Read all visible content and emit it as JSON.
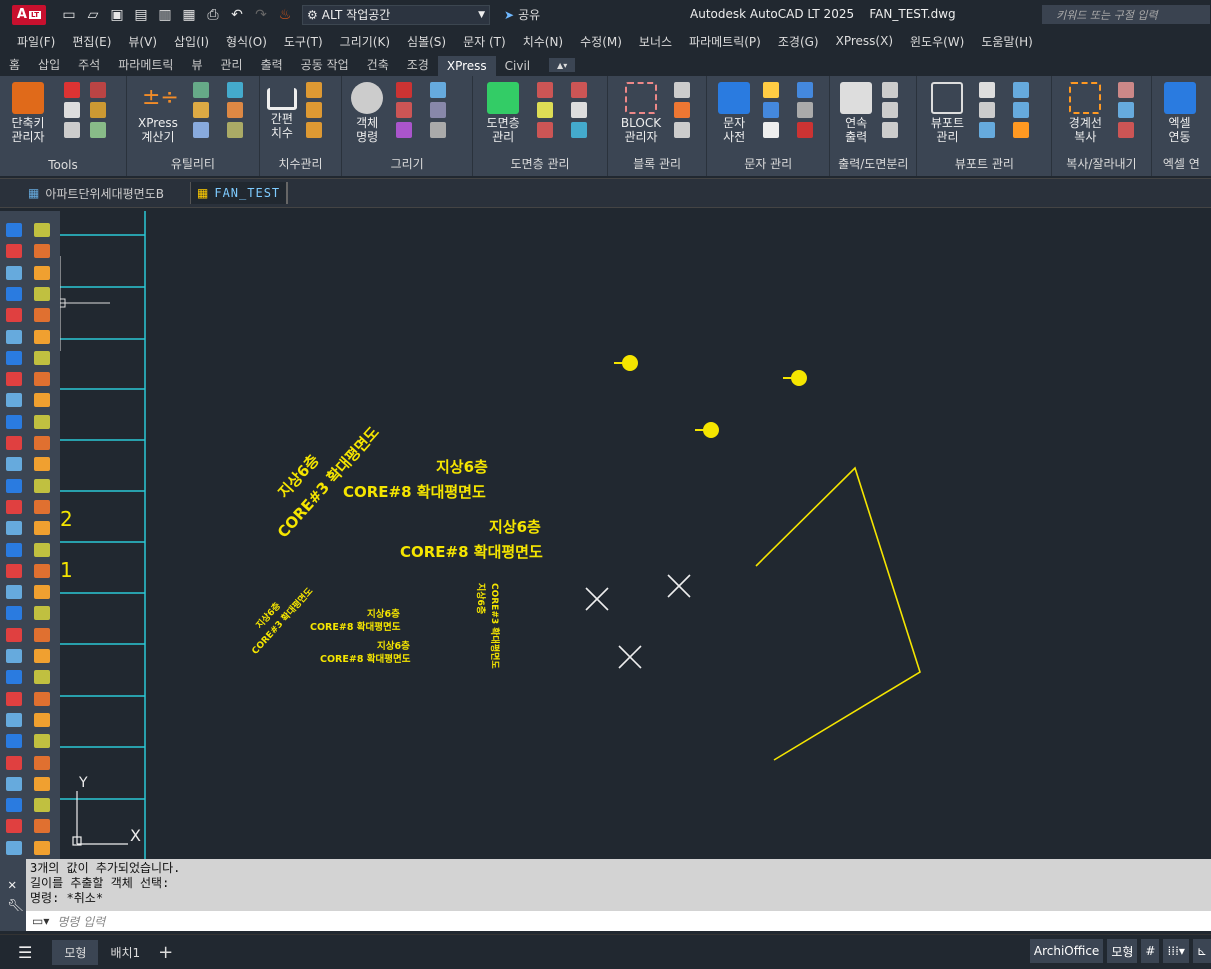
{
  "title_bar": {
    "logo_text": "A",
    "logo_badge": "LT",
    "workspace": "ALT 작업공간",
    "share": "공유",
    "app_title": "Autodesk AutoCAD LT 2025",
    "file_name": "FAN_TEST.dwg",
    "search_placeholder": "키워드 또는 구절 입력"
  },
  "menus": [
    "파일(F)",
    "편집(E)",
    "뷰(V)",
    "삽입(I)",
    "형식(O)",
    "도구(T)",
    "그리기(K)",
    "심볼(S)",
    "문자 (T)",
    "치수(N)",
    "수정(M)",
    "보너스",
    "파라메트릭(P)",
    "조경(G)",
    "XPress(X)",
    "윈도우(W)",
    "도움말(H)"
  ],
  "ribbon_tabs": [
    "홈",
    "삽입",
    "주석",
    "파라메트릭",
    "뷰",
    "관리",
    "출력",
    "공동 작업",
    "건축",
    "조경",
    "XPress",
    "Civil"
  ],
  "ribbon_active_tab": "XPress",
  "ribbon": {
    "tools": {
      "big": "단축키\n관리자",
      "title": "Tools"
    },
    "util": {
      "big": "XPress\n계산기",
      "title": "유틸리티"
    },
    "dim": {
      "big": "간편\n치수",
      "title": "치수관리"
    },
    "draw": {
      "big": "객체\n명령",
      "title": "그리기"
    },
    "layer": {
      "big": "도면층\n관리",
      "title": "도면층 관리"
    },
    "block": {
      "big": "BLOCK\n관리자",
      "title": "블록 관리"
    },
    "text": {
      "big": "문자\n사전",
      "title": "문자 관리"
    },
    "plot": {
      "big": "연속\n출력",
      "title": "출력/도면분리"
    },
    "viewport": {
      "big": "뷰포트\n관리",
      "title": "뷰포트 관리"
    },
    "copy": {
      "big": "경계선\n복사",
      "title": "복사/잘라내기"
    },
    "excel": {
      "big": "엑셀\n연동",
      "title": "엑셀 연"
    }
  },
  "file_tabs": [
    {
      "label": "아파트단위세대평면도B"
    },
    {
      "label": "FAN_TEST"
    }
  ],
  "drawing": {
    "texts": [
      {
        "l1": "지상6층",
        "l2": "CORE#3 확대평면도"
      },
      {
        "l1": "지상6층",
        "l2": "CORE#8 확대평면도"
      },
      {
        "l1": "지상6층",
        "l2": "CORE#8 확대평면도"
      },
      {
        "l1": "지상6층",
        "l2": "CORE#3 확대평면도"
      },
      {
        "l1": "지상6층",
        "l2": "CORE#8 확대평면도"
      },
      {
        "l1": "지상6층",
        "l2": "CORE#8 확대평면도"
      },
      {
        "l1": "지상6층",
        "l2": "CORE#3 확대평면도"
      }
    ],
    "grid_labels": [
      "2",
      "1"
    ],
    "ucs_y": "Y",
    "ucs_x": "X"
  },
  "command": {
    "history": [
      "3개의 값이 추가되었습니다.",
      "길이를 추출할 객체 선택:",
      "명령: *취소*"
    ],
    "placeholder": "명령 입력"
  },
  "layout_tabs": [
    "모형",
    "배치1"
  ],
  "status": {
    "archi": "ArchiOffice",
    "model": "모형"
  },
  "colors": {
    "background": "#212830",
    "ribbon": "#3b4553",
    "yellow": "#f5e500",
    "cyan": "#2bc7d6"
  }
}
